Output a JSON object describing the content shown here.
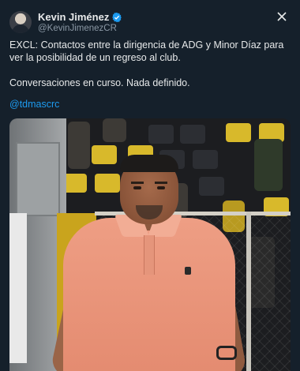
{
  "author": {
    "name": "Kevin Jiménez",
    "handle": "@KevinJimenezCR",
    "verified": true
  },
  "post": {
    "paragraph_1": "EXCL: Contactos entre la dirigencia de ADG y Minor Díaz para ver la posibilidad de un regreso al club.",
    "paragraph_2": "Conversaciones en curso. Nada definido.",
    "mention": "@tdmascrc"
  },
  "colors": {
    "background": "#15202b",
    "text": "#e7e9ea",
    "muted": "#8b98a5",
    "link": "#1d9bf0",
    "verified": "#1d9bf0"
  },
  "icons": [
    "avatar",
    "verified-badge-icon",
    "close-icon"
  ]
}
